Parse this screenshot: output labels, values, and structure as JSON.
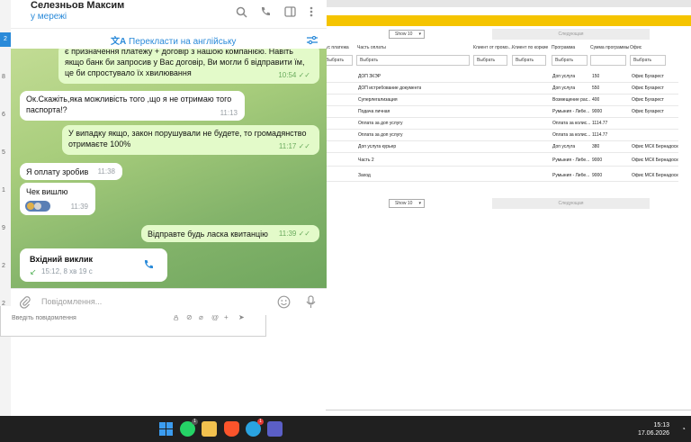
{
  "background_app": {
    "pager": {
      "show": "Show 10",
      "next": "Следующая"
    },
    "columns": [
      "ус платежа",
      "Часть оплаты",
      "Клиент от промо...",
      "Клиент по коркие",
      "Программа",
      "Сумма программы",
      "Офис"
    ],
    "filters": [
      "Выбрать",
      "Выбрать",
      "Выбрать",
      "Выбрать",
      "Выбрать",
      "Выбрать"
    ],
    "rows": [
      {
        "part": "ДОП ЗКЭР",
        "program": "Доп услуга",
        "sum": "150",
        "office": "Офис Бухарест"
      },
      {
        "part": "ДОП истребование документа",
        "program": "Доп услуга",
        "sum": "550",
        "office": "Офис Бухарест"
      },
      {
        "part": "Суперлегализация",
        "program": "Возмещение рас...",
        "sum": "400",
        "office": "Офис Бухарест"
      },
      {
        "part": "Подача личная",
        "program": "Румыния - Либе...",
        "sum": "9000",
        "office": "Офис Бухарест"
      },
      {
        "part": "Оплата за доп услугу",
        "program": "Оплата за колис...",
        "sum": "1114.77",
        "office": ""
      },
      {
        "part": "Оплата за доп услугу",
        "program": "Оплата за колис...",
        "sum": "1114.77",
        "office": ""
      },
      {
        "part": "Доп услуга курьер",
        "program": "Доп услуга",
        "sum": "380",
        "office": "Офис МСК Бернадоского"
      },
      {
        "part": "Часть 2",
        "program": "Румыния - Либе...",
        "sum": "9000",
        "office": "Офис МСК Бернадоского"
      },
      {
        "part": "Заход",
        "program": "Румыния - Либе...",
        "sum": "9000",
        "office": "Офис МСК Бернадоского"
      }
    ]
  },
  "behind_window": {
    "placeholder": "Введіть повідомлення"
  },
  "side_numbers": [
    "2",
    "8",
    "6",
    "5",
    "1",
    "9",
    "2",
    "2"
  ],
  "telegram": {
    "contact_name": "Селезньов Максим",
    "status": "у мережі",
    "translate_label": "Перекласти на англійську",
    "messages": [
      {
        "dir": "out",
        "text": "є призначення платежу + договір з нашою компанією. Навіть якщо банк би запросив у Вас договір, Ви могли б відправити їм, це би спростувало їх хвилювання",
        "time": "10:54"
      },
      {
        "dir": "in",
        "text": "Ок.Скажіть,яка можливість того ,що я не отримаю того паспорта!?",
        "time": "11:13"
      },
      {
        "dir": "out",
        "text": "У випадку якщо, закон порушували не будете, то громадянство отримаєте 100%",
        "time": "11:17"
      },
      {
        "dir": "in",
        "text": "Я оплату зробив",
        "time": "11:38"
      },
      {
        "dir": "in",
        "text": "Чек вишлю",
        "time": "11:39"
      },
      {
        "dir": "out",
        "text": "Відправте будь ласка квитанцію",
        "time": "11:39"
      }
    ],
    "call": {
      "title": "Вхідний виклик",
      "detail": "15:12, 8 хв 19 с"
    },
    "input_placeholder": "Повідомлення..."
  },
  "taskbar": {
    "time": "15:13",
    "date": "17.06.2026",
    "whatsapp_badge": "1",
    "telegram_badge": "1"
  },
  "colors": {
    "accent": "#2a8ad9",
    "yellow": "#f5c400",
    "out_bubble": "#e3fac9"
  }
}
